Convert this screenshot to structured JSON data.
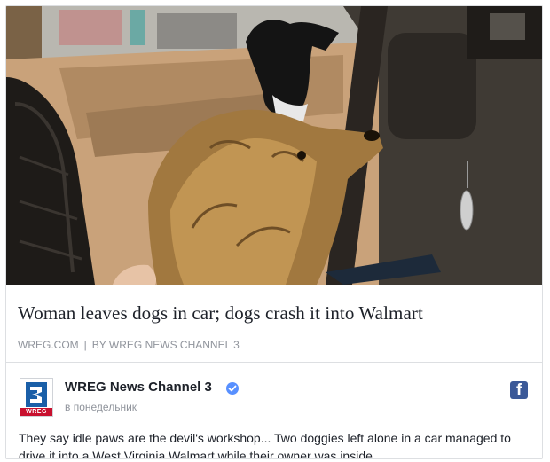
{
  "link_preview": {
    "headline": "Woman leaves dogs in car; dogs crash it into Walmart",
    "source": "WREG.COM",
    "byline": "BY WREG NEWS CHANNEL 3"
  },
  "post": {
    "page_name": "WREG News Channel 3",
    "timestamp": "в понедельник",
    "avatar_label": "WREG",
    "text": "They say idle paws are the devil's workshop... Two doggies left alone in a car managed to drive it into a West Virginia Walmart while their owner was inside."
  },
  "icons": {
    "verified": "verified-badge-icon",
    "facebook": "facebook-icon"
  },
  "colors": {
    "accent": "#3b5998",
    "verified": "#5890ff",
    "meta_gray": "#90949c",
    "brand_red": "#c8102e",
    "text": "#1d2129"
  }
}
